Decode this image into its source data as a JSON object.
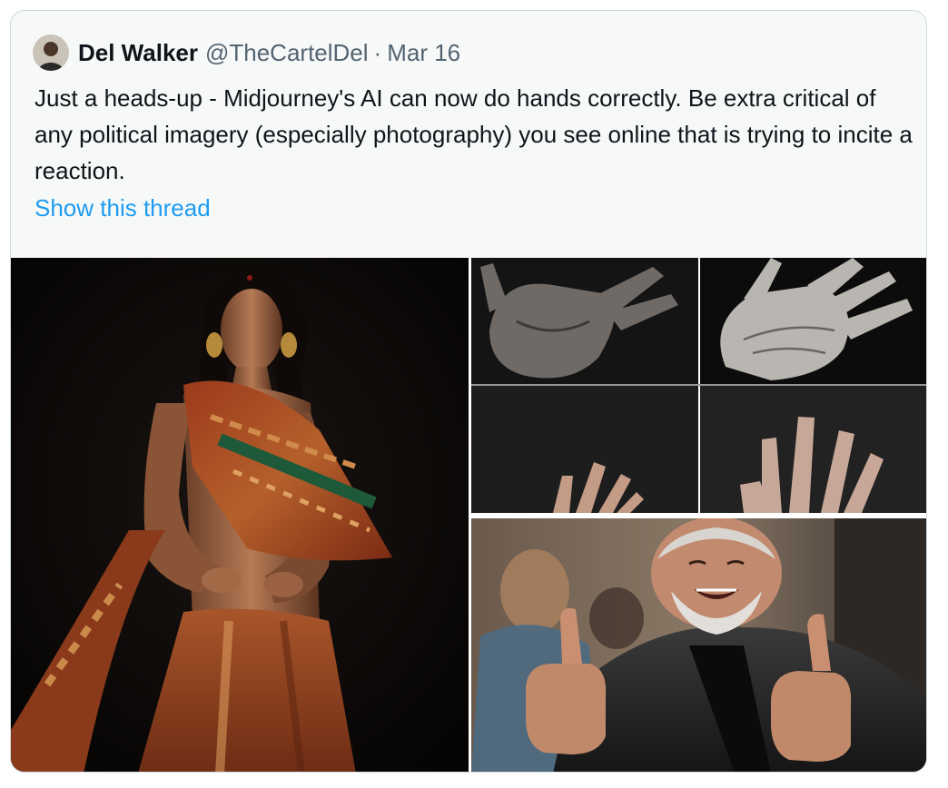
{
  "tweet": {
    "author_name": "Del Walker",
    "handle": "@TheCartelDel",
    "separator": "·",
    "date": "Mar 16",
    "text": "Just a heads-up - Midjourney's AI can now do hands correctly. Be extra critical of any political imagery (especially photography) you see online that is trying to incite a reaction.",
    "show_thread_label": "Show this thread"
  },
  "media": {
    "count": 3,
    "photos": [
      {
        "subject": "woman in patterned sari on dark background"
      },
      {
        "subject": "grid of four photographic close-ups of hands"
      },
      {
        "subject": "smiling grey-bearded man giving two thumbs up"
      }
    ]
  },
  "colors": {
    "link": "#1d9bf0",
    "text_primary": "#0f1419",
    "text_secondary": "#536471",
    "card_background": "#f7f9f9",
    "border": "#cfd9de"
  }
}
